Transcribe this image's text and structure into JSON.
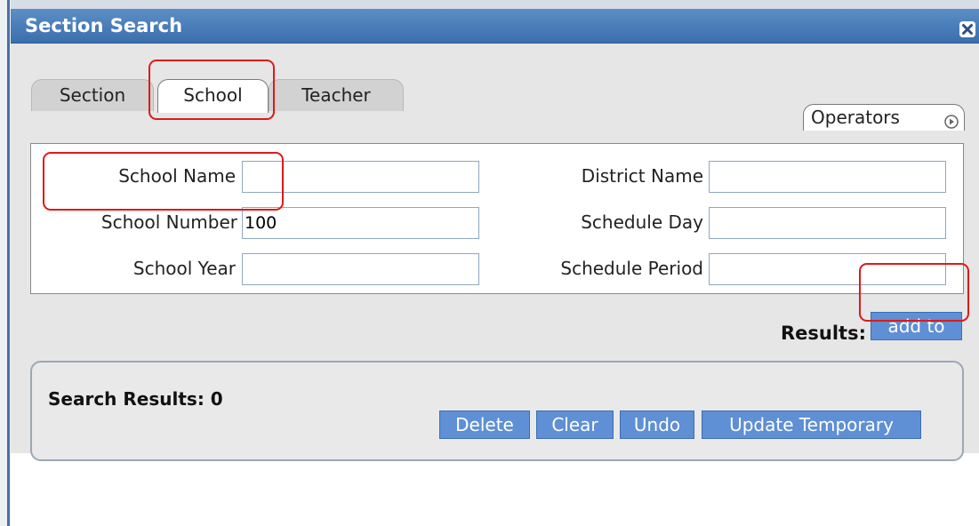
{
  "dialog": {
    "title": "Section Search",
    "close_icon": "close-icon"
  },
  "tabs": [
    {
      "label": "Section",
      "active": false
    },
    {
      "label": "School",
      "active": true
    },
    {
      "label": "Teacher",
      "active": false
    }
  ],
  "operators": {
    "label": "Operators",
    "icon": "play-circle-icon"
  },
  "fields": {
    "school_name": {
      "label": "School Name",
      "value": ""
    },
    "school_number": {
      "label": "School Number",
      "value": "100"
    },
    "school_year": {
      "label": "School Year",
      "value": ""
    },
    "district_name": {
      "label": "District Name",
      "value": ""
    },
    "schedule_day": {
      "label": "Schedule Day",
      "value": ""
    },
    "schedule_period": {
      "label": "Schedule Period",
      "value": ""
    }
  },
  "results_bar": {
    "label": "Results:",
    "button": "add to"
  },
  "search_results": {
    "count_text": "Search Results: 0",
    "buttons": {
      "delete": "Delete",
      "clear": "Clear",
      "undo": "Undo",
      "update_temporary": "Update Temporary"
    }
  },
  "colors": {
    "titlebar": "#4a7fbd",
    "button": "#5f8fd4",
    "highlight": "#e01919"
  }
}
